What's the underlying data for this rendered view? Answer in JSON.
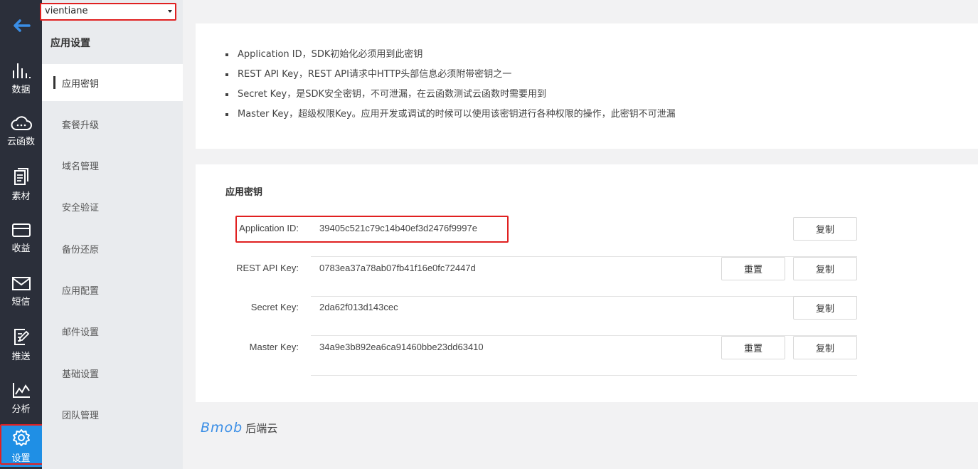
{
  "app_selector": {
    "value": "vientiane"
  },
  "rail": {
    "items": [
      {
        "label": "数据",
        "icon": "bar-chart-icon"
      },
      {
        "label": "云函数",
        "icon": "cloud-icon"
      },
      {
        "label": "素材",
        "icon": "documents-icon"
      },
      {
        "label": "收益",
        "icon": "card-icon"
      },
      {
        "label": "短信",
        "icon": "mail-icon"
      },
      {
        "label": "推送",
        "icon": "push-icon"
      },
      {
        "label": "分析",
        "icon": "line-chart-icon"
      },
      {
        "label": "设置",
        "icon": "gear-icon",
        "active": true
      }
    ]
  },
  "sidebar": {
    "heading": "应用设置",
    "items": [
      {
        "label": "应用密钥",
        "active": true
      },
      {
        "label": "套餐升级"
      },
      {
        "label": "域名管理"
      },
      {
        "label": "安全验证"
      },
      {
        "label": "备份还原"
      },
      {
        "label": "应用配置"
      },
      {
        "label": "邮件设置"
      },
      {
        "label": "基础设置"
      },
      {
        "label": "团队管理"
      }
    ]
  },
  "info": {
    "lines": [
      "Application ID，SDK初始化必须用到此密钥",
      "REST API Key，REST API请求中HTTP头部信息必须附带密钥之一",
      "Secret Key，是SDK安全密钥，不可泄漏，在云函数测试云函数时需要用到",
      "Master Key，超级权限Key。应用开发或调试的时候可以使用该密钥进行各种权限的操作，此密钥不可泄漏"
    ]
  },
  "keys": {
    "title": "应用密钥",
    "copy_label": "复制",
    "reset_label": "重置",
    "rows": [
      {
        "label": "Application ID:",
        "value": "39405c521c79c14b40ef3d2476f9997e"
      },
      {
        "label": "REST API Key:",
        "value": "0783ea37a78ab07fb41f16e0fc72447d"
      },
      {
        "label": "Secret Key:",
        "value": "2da62f013d143cec"
      },
      {
        "label": "Master Key:",
        "value": "34a9e3b892ea6ca91460bbe23dd63410"
      }
    ]
  },
  "brand": {
    "logo": "Bmob",
    "name": "后端云"
  },
  "colors": {
    "accent": "#1f8fe5",
    "rail_bg": "#2b2f3a",
    "highlight": "#e02020"
  }
}
